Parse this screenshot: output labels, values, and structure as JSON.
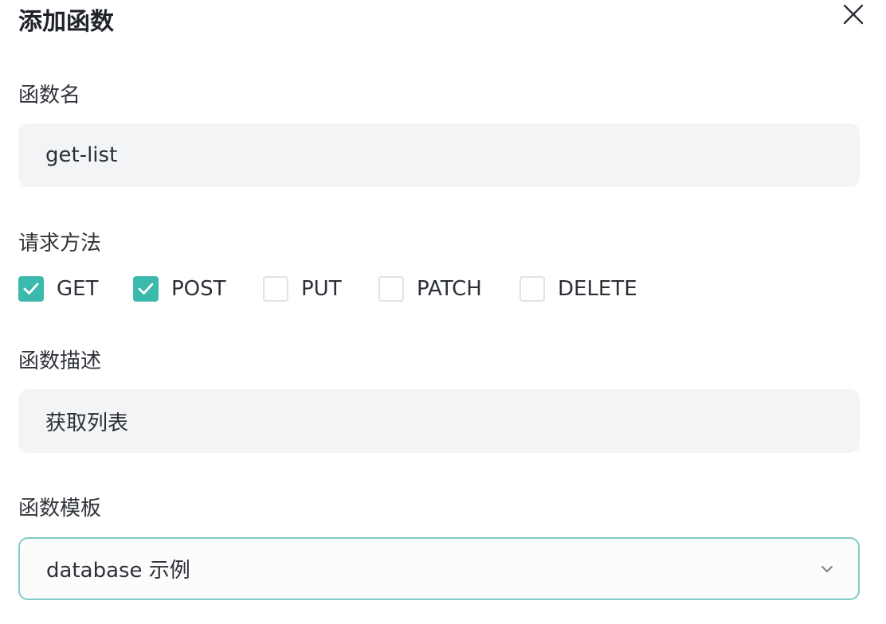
{
  "dialog": {
    "title": "添加函数",
    "close_icon": "close-icon"
  },
  "function_name": {
    "label": "函数名",
    "value": "get-list"
  },
  "request_method": {
    "label": "请求方法",
    "options": [
      {
        "label": "GET",
        "checked": true
      },
      {
        "label": "POST",
        "checked": true
      },
      {
        "label": "PUT",
        "checked": false
      },
      {
        "label": "PATCH",
        "checked": false
      },
      {
        "label": "DELETE",
        "checked": false
      }
    ]
  },
  "description": {
    "label": "函数描述",
    "value": "获取列表"
  },
  "template": {
    "label": "函数模板",
    "selected": "database 示例",
    "icon": "chevron-down-icon"
  },
  "colors": {
    "accent": "#3bb9ac",
    "select_border": "#7fcdc5",
    "input_bg": "#f3f4f6"
  }
}
